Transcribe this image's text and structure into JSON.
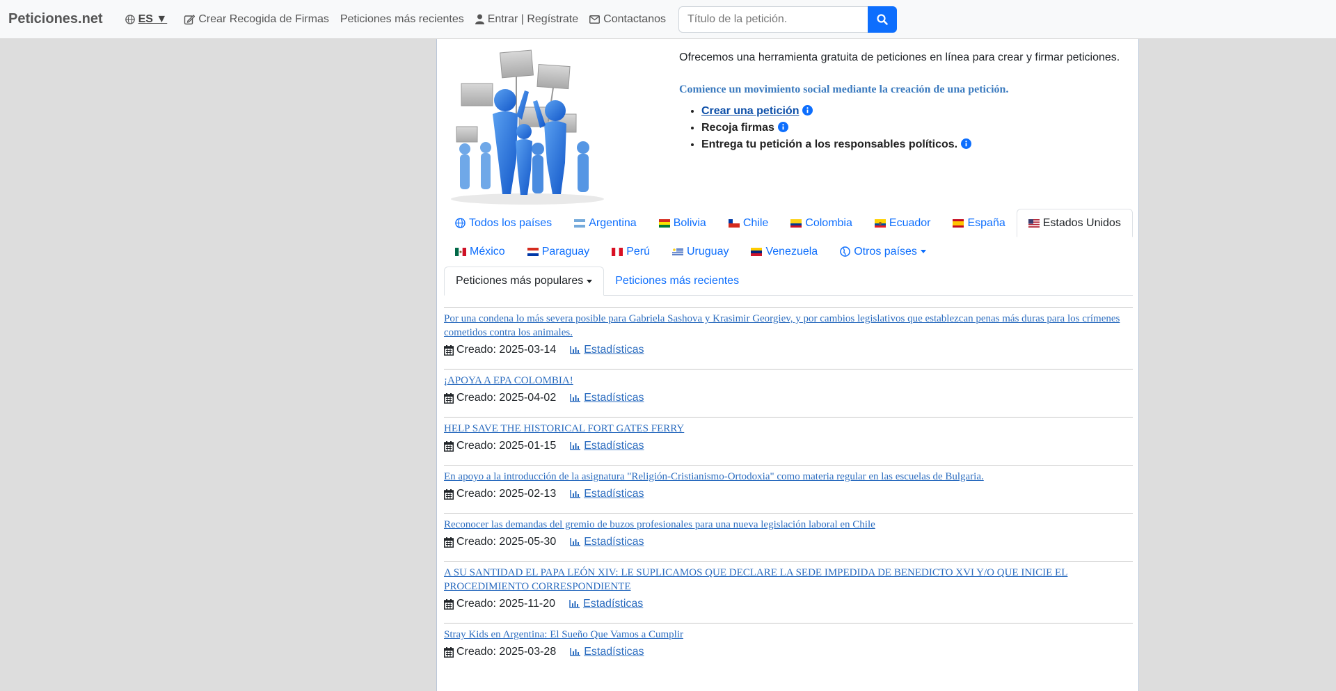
{
  "nav": {
    "brand": "Peticiones.net",
    "lang": "ES ▼",
    "create": "Crear Recogida de Firmas",
    "recent": "Peticiones más recientes",
    "login": "Entrar | Regístrate",
    "contact": "Contactanos",
    "search_placeholder": "Título de la petición."
  },
  "hero": {
    "intro": "Ofrecemos una herramienta gratuita de peticiones en línea para crear y firmar peticiones.",
    "movement": "Comience un movimiento social mediante la creación de una petición.",
    "steps": [
      "Crear una petición",
      "Recoja firmas",
      "Entrega tu petición a los responsables políticos."
    ]
  },
  "countries": {
    "row1": [
      "Todos los países",
      "Argentina",
      "Bolivia",
      "Chile",
      "Colombia",
      "Ecuador",
      "España",
      "Estados Unidos"
    ],
    "row2": [
      "México",
      "Paraguay",
      "Perú",
      "Uruguay",
      "Venezuela",
      "Otros países"
    ],
    "active": "Estados Unidos"
  },
  "sort": {
    "popular": "Peticiones más populares",
    "recent": "Peticiones más recientes"
  },
  "petitions": [
    {
      "title": "Por una condena lo más severa posible para Gabriela Sashova y Krasimir Georgiev, y por cambios legislativos que establezcan penas más duras para los crímenes cometidos contra los animales.",
      "created": "Creado: 2025-03-14",
      "stats": "Estadísticas"
    },
    {
      "title": "¡APOYA A EPA COLOMBIA!",
      "created": "Creado: 2025-04-02",
      "stats": "Estadísticas"
    },
    {
      "title": "HELP SAVE THE HISTORICAL FORT GATES FERRY",
      "created": "Creado: 2025-01-15",
      "stats": "Estadísticas"
    },
    {
      "title": "En apoyo a la introducción de la asignatura \"Religión-Cristianismo-Ortodoxia\" como materia regular en las escuelas de Bulgaria.",
      "created": "Creado: 2025-02-13",
      "stats": "Estadísticas"
    },
    {
      "title": "Reconocer las demandas del gremio de buzos profesionales para una nueva legislación laboral en Chile",
      "created": "Creado: 2025-05-30",
      "stats": "Estadísticas"
    },
    {
      "title": "A SU SANTIDAD EL PAPA LEÓN XIV: LE SUPLICAMOS QUE DECLARE LA SEDE IMPEDIDA DE BENEDICTO XVI Y/O QUE INICIE EL PROCEDIMIENTO CORRESPONDIENTE",
      "created": "Creado: 2025-11-20",
      "stats": "Estadísticas"
    },
    {
      "title": "Stray Kids en Argentina: El Sueño Que Vamos a Cumplir",
      "created": "Creado: 2025-03-28",
      "stats": "Estadísticas"
    }
  ]
}
